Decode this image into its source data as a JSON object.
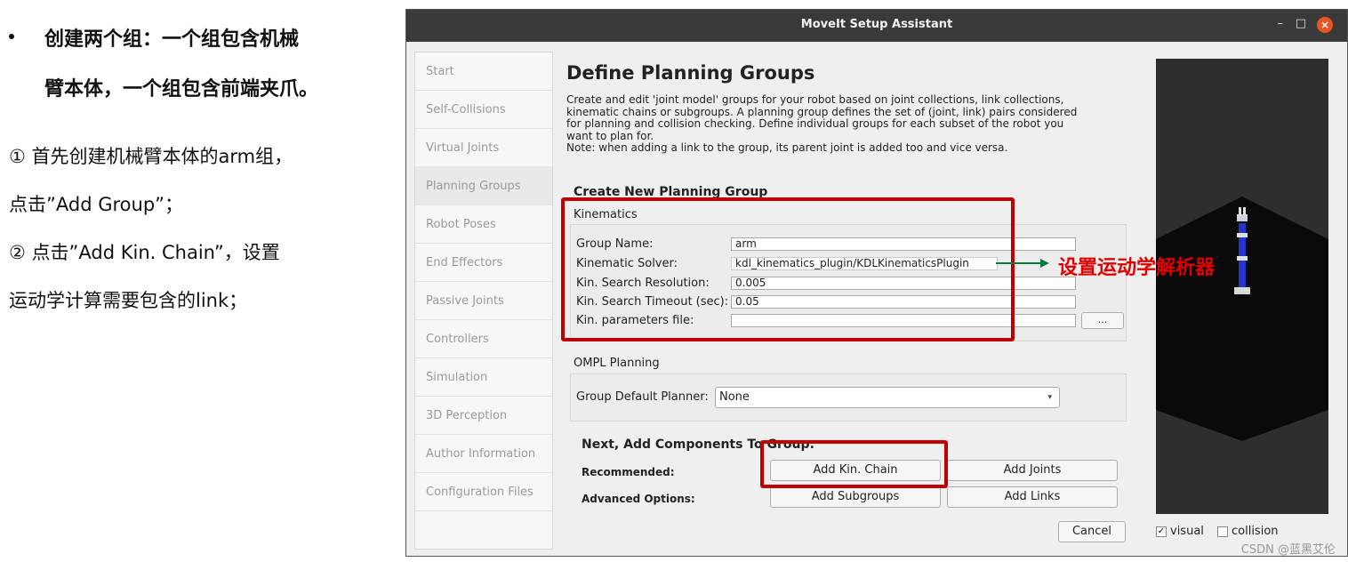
{
  "notes": {
    "bullet_line1": "创建两个组：一个组包含机械",
    "bullet_line2": "臂本体，一个组包含前端夹爪。",
    "step1_line1": "① 首先创建机械臂本体的arm组，",
    "step1_line2": "点击”Add Group”；",
    "step2_line1": "② 点击”Add Kin. Chain”，设置",
    "step2_line2": "运动学计算需要包含的link；"
  },
  "window": {
    "title": "MoveIt Setup Assistant",
    "minimize": "–",
    "maximize": "□",
    "close": "×"
  },
  "sidebar": {
    "items": [
      {
        "label": "Start"
      },
      {
        "label": "Self-Collisions"
      },
      {
        "label": "Virtual Joints"
      },
      {
        "label": "Planning Groups"
      },
      {
        "label": "Robot Poses"
      },
      {
        "label": "End Effectors"
      },
      {
        "label": "Passive Joints"
      },
      {
        "label": "Controllers"
      },
      {
        "label": "Simulation"
      },
      {
        "label": "3D Perception"
      },
      {
        "label": "Author Information"
      },
      {
        "label": "Configuration Files"
      }
    ]
  },
  "main": {
    "title": "Define Planning Groups",
    "desc_lines": [
      "Create and edit 'joint model' groups for your robot based on joint collections, link collections,",
      "kinematic chains or subgroups. A planning group defines the set of (joint, link) pairs considered",
      "for planning and collision checking. Define individual groups for each subset of the robot you",
      "want to plan for.",
      "Note: when adding a link to the group, its parent joint is added too and vice versa."
    ],
    "section_title": "Create New Planning Group",
    "kinematics": {
      "label": "Kinematics",
      "group_name_label": "Group Name:",
      "group_name_value": "arm",
      "solver_label": "Kinematic Solver:",
      "solver_value": "kdl_kinematics_plugin/KDLKinematicsPlugin",
      "resolution_label": "Kin. Search Resolution:",
      "resolution_value": "0.005",
      "timeout_label": "Kin. Search Timeout (sec):",
      "timeout_value": "0.05",
      "params_label": "Kin. parameters file:",
      "params_value": "",
      "browse_label": "..."
    },
    "ompl": {
      "label": "OMPL Planning",
      "planner_label": "Group Default Planner:",
      "planner_value": "None"
    },
    "components": {
      "title": "Next, Add Components To Group:",
      "recommended_label": "Recommended:",
      "advanced_label": "Advanced Options:",
      "add_kin_chain": "Add Kin. Chain",
      "add_joints": "Add Joints",
      "add_subgroups": "Add Subgroups",
      "add_links": "Add Links"
    },
    "cancel": "Cancel"
  },
  "annotation": {
    "text": "设置运动学解析器",
    "color": "#e00000"
  },
  "viewer": {
    "visual_label": "visual",
    "visual_checked": true,
    "collision_label": "collision",
    "collision_checked": false
  },
  "watermark": "CSDN @蓝黑艾伦",
  "colors": {
    "highlight_red": "#c00000",
    "titlebar": "#3a3a3a",
    "close_button": "#e95420"
  }
}
